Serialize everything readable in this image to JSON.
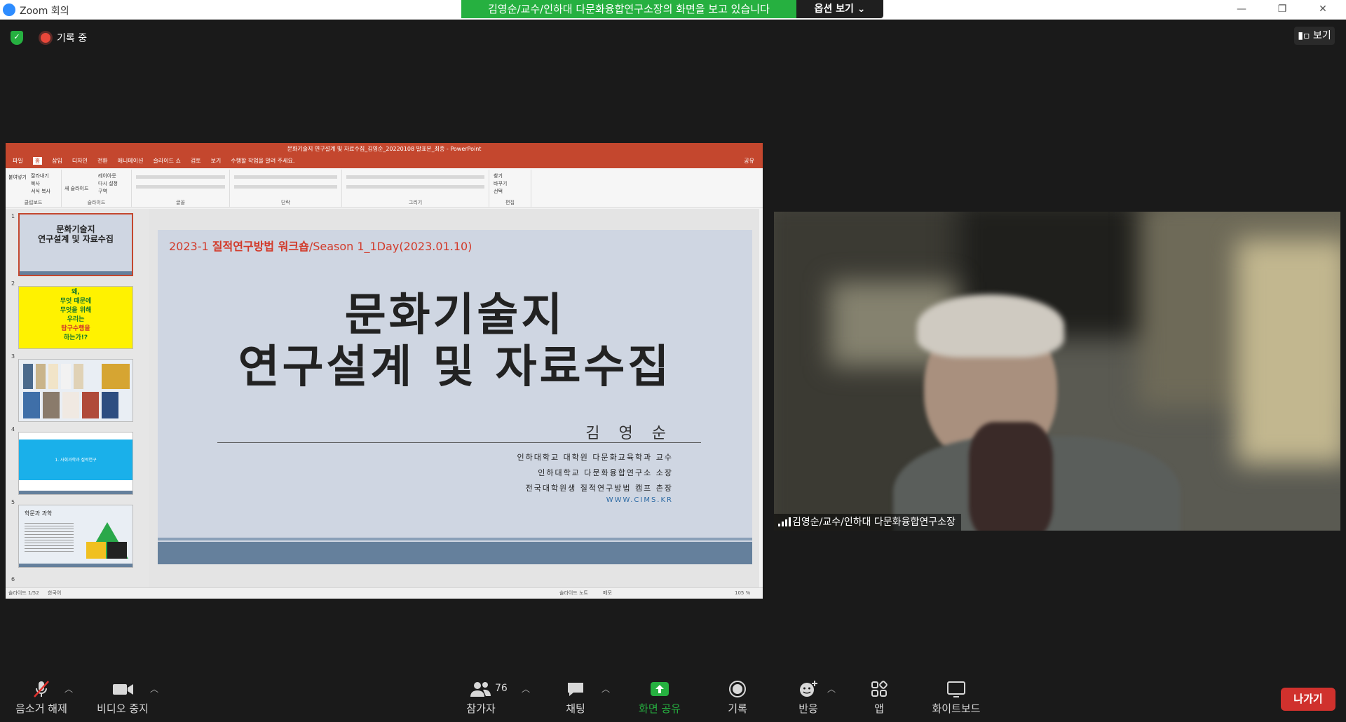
{
  "window": {
    "title": "Zoom 회의",
    "share_banner": "김영순/교수/인하대 다문화융합연구소장의 화면을 보고 있습니다",
    "view_options": "옵션 보기 ⌄",
    "minimize": "—",
    "restore": "❐",
    "close": "✕"
  },
  "meeting": {
    "recording_label": "기록 중",
    "view_label": "보기"
  },
  "powerpoint": {
    "title": "문화기술지 연구설계 및 자료수집_김영순_20220108 발표본_최종 - PowerPoint",
    "menu": [
      "파일",
      "홈",
      "삽입",
      "디자인",
      "전환",
      "애니메이션",
      "슬라이드 쇼",
      "검토",
      "보기",
      "수행할 작업을 알려 주세요."
    ],
    "active_menu_index": 1,
    "share_label": "공유",
    "ribbon_groups": [
      "클립보드",
      "슬라이드",
      "글꼴",
      "단락",
      "그리기",
      "편집"
    ],
    "ribbon_items": {
      "paste": "붙여넣기",
      "cut": "잘라내기",
      "copy": "복사",
      "format": "서식 복사",
      "new_slide": "새 슬라이드",
      "layout": "레이아웃",
      "reset": "다시 설정",
      "section": "구역",
      "find": "찾기",
      "replace": "바꾸기",
      "select": "선택"
    },
    "thumb_numbers": [
      "1",
      "2",
      "3",
      "4",
      "5",
      "6"
    ],
    "thumb2_text": [
      "왜,",
      "무엇 때문에",
      "무엇을 위해",
      "우리는",
      "탐구수행을",
      "하는가!?"
    ],
    "thumb4_text": "1. 사회과학과 질적연구",
    "thumb5_title": "학문과 과학",
    "status": {
      "slide_of": "슬라이드 1/52",
      "language": "한국어",
      "notes": "슬라이드 노트",
      "comments": "메모",
      "zoom": "105 %"
    },
    "slide": {
      "header_prefix": "2023-1 ",
      "header_bold": "질적연구방법 워크숍",
      "header_suffix": "/Season 1_1Day(2023.01.10)",
      "title_line1": "문화기술지",
      "title_line2": "연구설계 및 자료수집",
      "author": "김 영 순",
      "affiliation1": "인하대학교 대학원 다문화교육학과 교수",
      "affiliation2": "인하대학교 다문화융합연구소 소장",
      "affiliation3": "전국대학원생 질적연구방법 캠프 촌장",
      "url": "WWW.CIMS.KR"
    }
  },
  "video": {
    "participant_name": "김영순/교수/인하대 다문화융합연구소장"
  },
  "toolbar": {
    "mute": "음소거 해제",
    "video": "비디오 중지",
    "participants": "참가자",
    "participants_count": "76",
    "chat": "채팅",
    "share": "화면 공유",
    "record": "기록",
    "reactions": "반응",
    "apps": "앱",
    "whiteboard": "화이트보드",
    "leave": "나가기"
  },
  "colors": {
    "share_green": "#26b040",
    "leave_red": "#d0312d",
    "ppt_red": "#c4472e"
  }
}
